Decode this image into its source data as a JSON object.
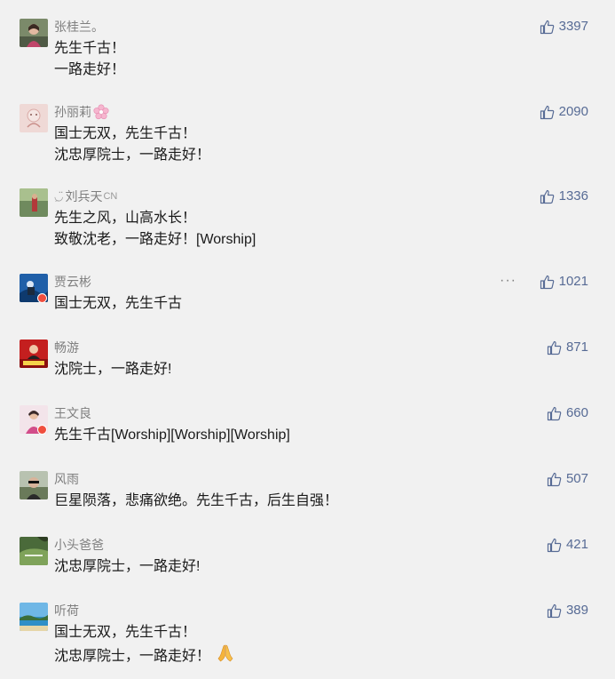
{
  "comments": [
    {
      "nickname": "张桂兰。",
      "lines": [
        "先生千古！",
        "一路走好！"
      ],
      "likes": "3397"
    },
    {
      "nickname": "孙丽莉",
      "nickname_emoji": "cherry-blossom-icon",
      "lines": [
        "国士无双，先生千古！",
        "沈忠厚院士，一路走好！"
      ],
      "likes": "2090"
    },
    {
      "nickname_prefix": "ِ◡̈",
      "nickname": "刘兵天",
      "nickname_suffix": "CN",
      "lines": [
        "先生之风，山高水长！",
        "致敬沈老，一路走好！[Worship]"
      ],
      "likes": "1336"
    },
    {
      "nickname": "贾云彬",
      "lines": [
        "国士无双，先生千古"
      ],
      "likes": "1021",
      "more_label": "···"
    },
    {
      "nickname": "畅游",
      "lines": [
        "沈院士，一路走好!"
      ],
      "likes": "871"
    },
    {
      "nickname": "王文良",
      "lines": [
        "先生千古[Worship][Worship][Worship]"
      ],
      "likes": "660"
    },
    {
      "nickname": "风雨",
      "lines": [
        "巨星陨落，悲痛欲绝。先生千古，后生自强！"
      ],
      "likes": "507"
    },
    {
      "nickname": "小头爸爸",
      "lines": [
        "沈忠厚院士，一路走好!"
      ],
      "likes": "421"
    },
    {
      "nickname": "听荷",
      "lines": [
        "国士无双，先生千古！",
        "沈忠厚院士，一路走好！"
      ],
      "likes": "389",
      "line_emoji": "folded-hands-icon"
    }
  ],
  "colors": {
    "background": "#f1f1f1",
    "like_blue": "#576b95",
    "nickname_gray": "#7f7f7f",
    "text": "#1a1a1a"
  }
}
